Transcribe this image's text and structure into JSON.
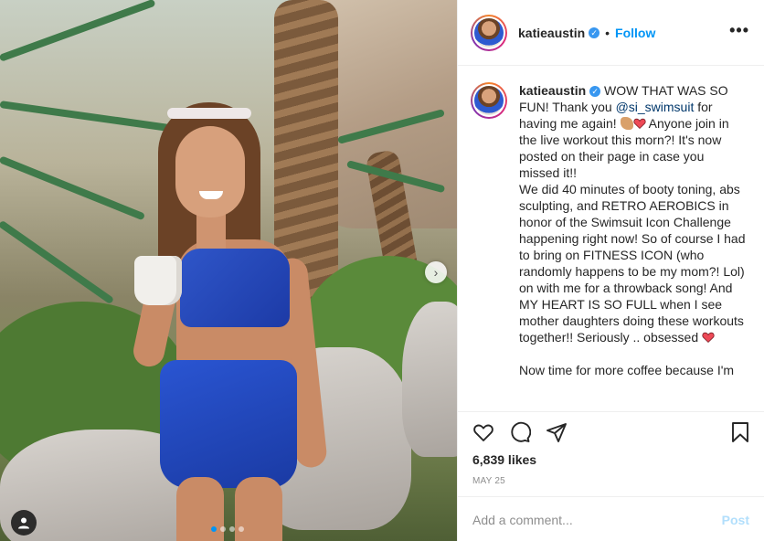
{
  "post": {
    "username": "katieaustin",
    "follow_label": "Follow",
    "separator": "•",
    "more_label": "•••",
    "verified_mark": "✓",
    "caption": {
      "username": "katieaustin",
      "part1": " WOW THAT WAS SO FUN! Thank you ",
      "mention": "@si_swimsuit",
      "part2": " for having me again! ",
      "part3": " Anyone join in the live workout this morn?! It's now posted on their page in case you missed it!!\nWe did 40 minutes of booty toning, abs sculpting, and RETRO AEROBICS in honor of the Swimsuit Icon Challenge happening right now! So of course I had to bring on FITNESS ICON (who randomly happens to be my mom?! Lol) on with me for a throwback song! And MY HEART IS SO FULL when I see mother daughters doing these workouts together!! Seriously .. obsessed ",
      "part4": "\n\nNow time for more coffee because I'm "
    },
    "likes": "6,839 likes",
    "date": "MAY 25",
    "comment_placeholder": "Add a comment...",
    "post_label": "Post"
  },
  "media": {
    "carousel_count": 4,
    "carousel_active": 1,
    "next_label": "›"
  },
  "icons": {
    "like": "heart-icon",
    "comment": "comment-icon",
    "share": "share-icon",
    "save": "bookmark-icon",
    "tag": "user-tag-icon",
    "verified": "verified-badge-icon"
  },
  "colors": {
    "accent": "#0095f6",
    "verified": "#3897f0",
    "post_disabled": "#b2dffc",
    "text": "#262626",
    "muted": "#8e8e8e"
  }
}
